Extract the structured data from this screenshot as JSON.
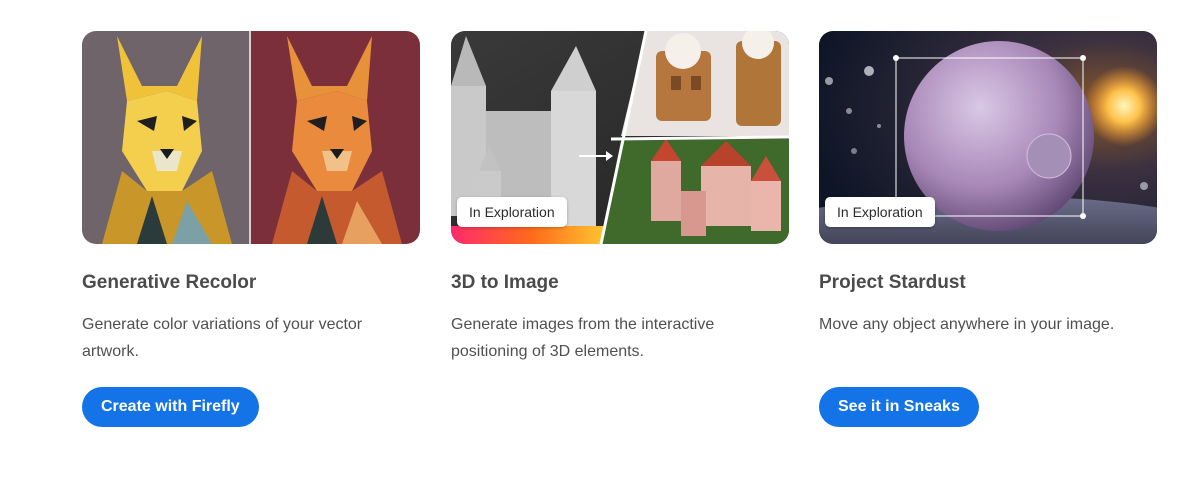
{
  "cards": [
    {
      "title": "Generative Recolor",
      "description": "Generate color variations of your vector artwork.",
      "button_label": "Create with Firefly",
      "badge": ""
    },
    {
      "title": "3D to Image",
      "description": "Generate images from the interactive positioning of 3D elements.",
      "button_label": "",
      "badge": "In Exploration"
    },
    {
      "title": "Project Stardust",
      "description": "Move any object anywhere in your image.",
      "button_label": "See it in Sneaks",
      "badge": "In Exploration"
    }
  ],
  "colors": {
    "button": "#1473e6",
    "title": "#4b4b4b",
    "text": "#505050"
  }
}
